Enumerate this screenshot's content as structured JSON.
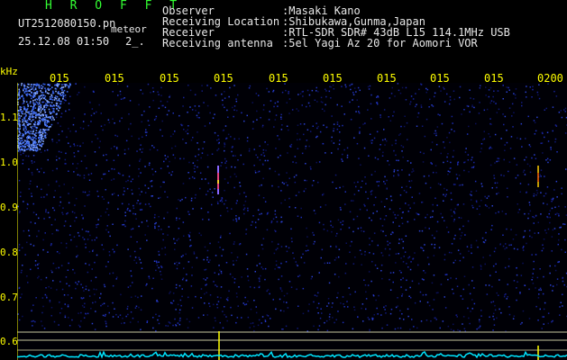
{
  "header": {
    "title": "H R O F F T",
    "file_name": "UT2512080150.pn",
    "meteor_label": "meteor",
    "date_time": "25.12.08 01:50",
    "meteor_count": "2_."
  },
  "info": [
    {
      "key": "Observer",
      "value": ":Masaki Kano"
    },
    {
      "key": "Receiving Location",
      "value": ":Shibukawa,Gunma,Japan"
    },
    {
      "key": "Receiver",
      "value": ":RTL-SDR SDR# 43dB L15 114.1MHz USB"
    },
    {
      "key": "Receiving antenna",
      "value": ":5el Yagi Az 20 for Aomori VOR"
    }
  ],
  "y_axis": {
    "unit": "kHz",
    "ticks": [
      "1.1",
      "1.0",
      "0.9",
      "0.8",
      "0.7",
      "0.6"
    ]
  },
  "x_axis": {
    "ticks": [
      "015",
      "015",
      "015",
      "015",
      "015",
      "015",
      "015",
      "015",
      "015",
      "0200"
    ]
  },
  "colors": {
    "background": "#000000",
    "label_yellow": "#ffff00",
    "title_green": "#33ff33",
    "text_white": "#e8e8e8",
    "noise_blue": "#1a237e",
    "baseline_cyan": "#00e5ff"
  }
}
